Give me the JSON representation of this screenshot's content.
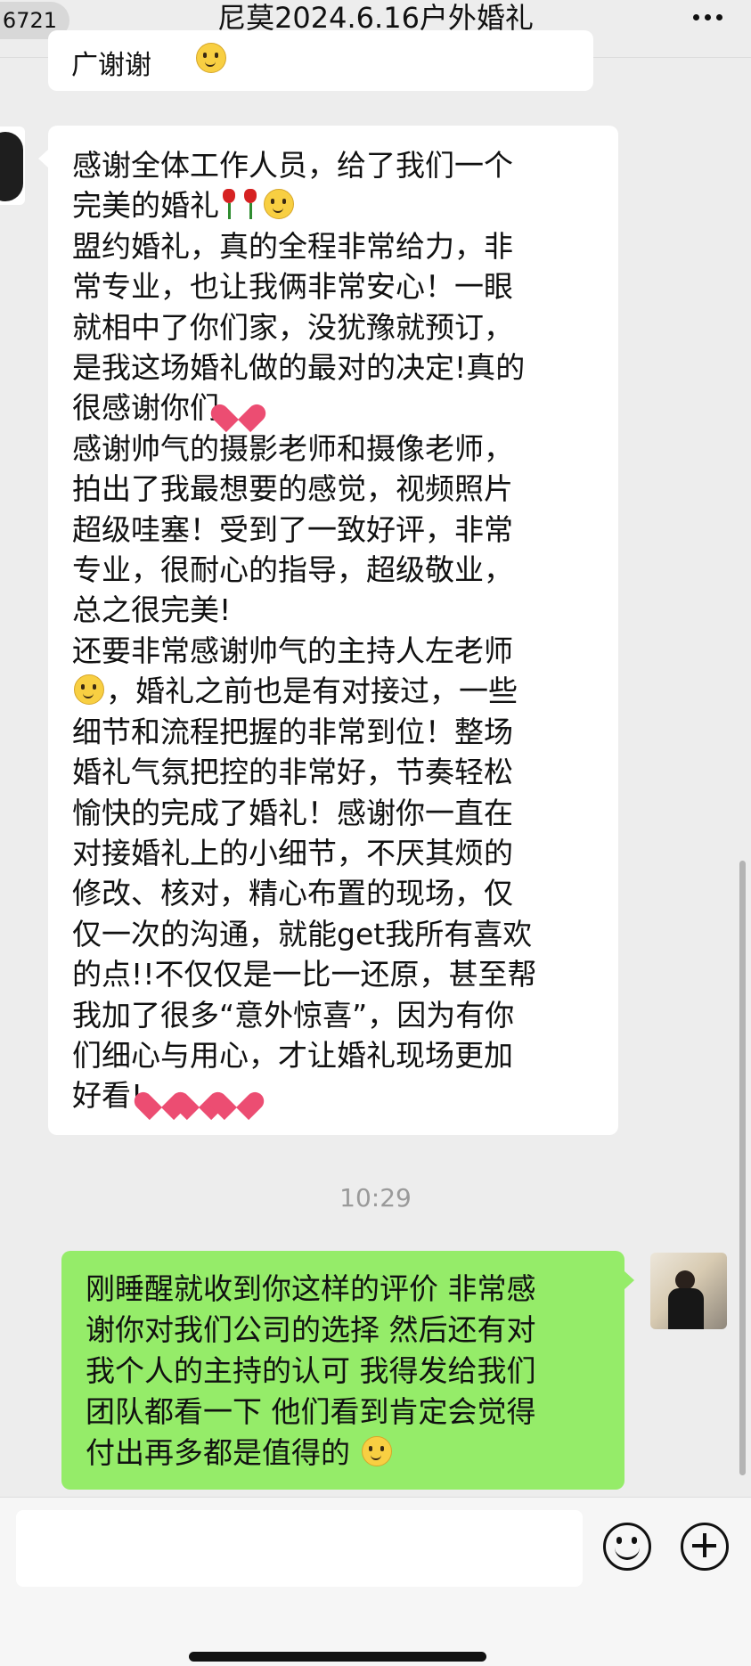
{
  "header": {
    "badge": "6721",
    "title": "尼莫2024.6.16户外婚礼",
    "more_icon": "more-icon"
  },
  "prev_message": {
    "text": "广谢谢"
  },
  "received_message": {
    "lines": [
      "感谢全体工作人员，给了我们一个",
      "完美的婚礼",
      "盟约婚礼，真的全程非常给力，非",
      "常专业，也让我俩非常安心！一眼",
      "就相中了你们家，没犹豫就预订，",
      "是我这场婚礼做的最对的决定!真的",
      "很感谢你们",
      "感谢帅气的摄影老师和摄像老师，",
      "拍出了我最想要的感觉，视频照片",
      "超级哇塞！受到了一致好评，非常",
      "专业，很耐心的指导，超级敬业，",
      "总之很完美!",
      "还要非常感谢帅气的主持人左老师",
      "，婚礼之前也是有对接过，一些",
      "细节和流程把握的非常到位！整场",
      "婚礼气氛把控的非常好，节奏轻松",
      "愉快的完成了婚礼！感谢你一直在",
      "对接婚礼上的小细节，不厌其烦的",
      "修改、核对，精心布置的现场，仅",
      "仅一次的沟通，就能get我所有喜欢",
      "的点!!不仅仅是一比一还原，甚至帮",
      "我加了很多“意外惊喜”，因为有你",
      "们细心与用心，才让婚礼现场更加",
      "好看!"
    ]
  },
  "timestamp": "10:29",
  "sent_message": {
    "lines": [
      "刚睡醒就收到你这样的评价 非常感",
      "谢你对我们公司的选择 然后还有对",
      "我个人的主持的认可 我得发给我们",
      "团队都看一下 他们看到肯定会觉得",
      "付出再多都是值得的"
    ]
  },
  "input": {
    "value": ""
  },
  "icons": {
    "emoji": "emoji-icon",
    "plus": "plus-icon",
    "heart": "heart-icon",
    "rose": "rose-icon",
    "face": "face-icon"
  },
  "colors": {
    "background": "#ededed",
    "sent_bubble": "#95ec69",
    "received_bubble": "#ffffff",
    "heart": "#ec4d72"
  }
}
